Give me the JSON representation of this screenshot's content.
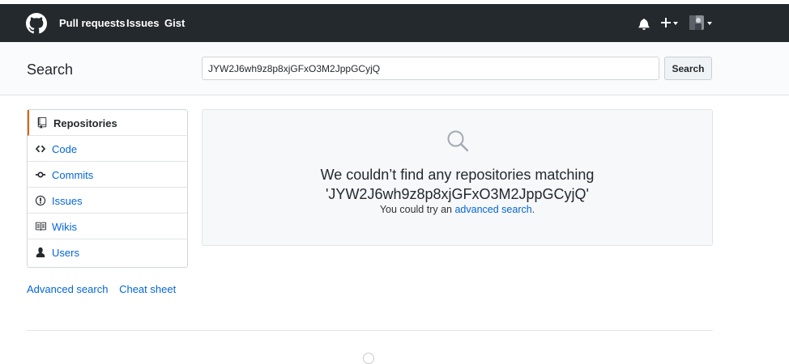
{
  "header": {
    "nav": [
      "Pull requests",
      "Issues",
      "Gist"
    ],
    "icons": [
      "github-logo-icon",
      "bell-icon",
      "plus-icon",
      "avatar"
    ]
  },
  "search": {
    "title": "Search",
    "query": "JYW2J6wh9z8p8xjGFxO3M2JppGCyjQ",
    "button_label": "Search"
  },
  "sidebar": {
    "items": [
      {
        "label": "Repositories",
        "icon": "repo-icon",
        "selected": true
      },
      {
        "label": "Code",
        "icon": "code-icon",
        "selected": false
      },
      {
        "label": "Commits",
        "icon": "commit-icon",
        "selected": false
      },
      {
        "label": "Issues",
        "icon": "issue-icon",
        "selected": false
      },
      {
        "label": "Wikis",
        "icon": "book-icon",
        "selected": false
      },
      {
        "label": "Users",
        "icon": "person-icon",
        "selected": false
      }
    ],
    "links": [
      "Advanced search",
      "Cheat sheet"
    ]
  },
  "results": {
    "title_line1": "We couldn’t find any repositories matching",
    "title_line2": "'JYW2J6wh9z8p8xjGFxO3M2JppGCyjQ'",
    "hint_prefix": "You could try an ",
    "hint_link": "advanced search",
    "hint_suffix": "."
  },
  "colors": {
    "header_bg": "#24292e",
    "link": "#0366d6",
    "selected_accent": "#e36209"
  }
}
